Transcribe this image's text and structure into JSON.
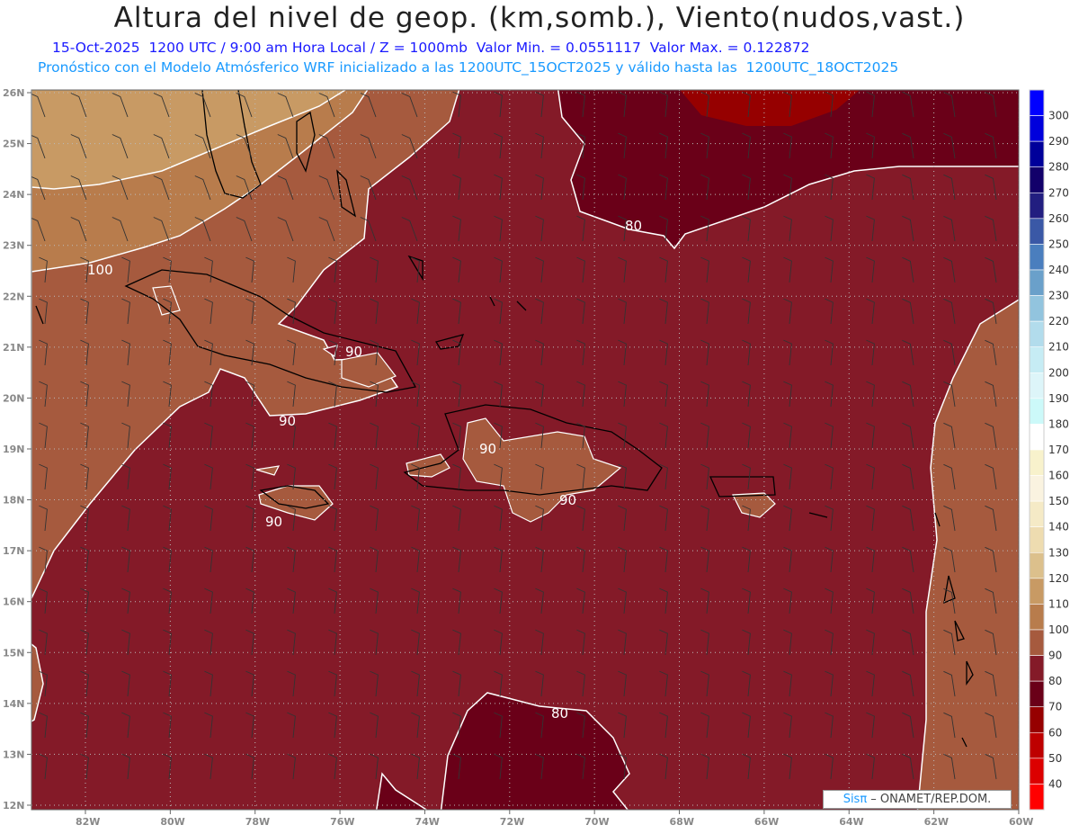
{
  "header": {
    "title": "Altura del nivel de geop. (km,somb.), Viento(nudos,vast.)",
    "subtitle": "15-Oct-2025  1200 UTC / 9:00 am Hora Local / Z = 1000mb  Valor Min. = 0.0551117  Valor Max. = 0.122872",
    "forecast_info": "Pronóstico con el Modelo Atmósferico WRF inicializado a las 1200UTC_15OCT2025 y válido hasta las  1200UTC_18OCT2025"
  },
  "map": {
    "lat_labels": [
      "26N",
      "25N",
      "24N",
      "23N",
      "22N",
      "21N",
      "20N",
      "19N",
      "18N",
      "17N",
      "16N",
      "15N",
      "14N",
      "13N",
      "12N"
    ],
    "lon_labels": [
      "82W",
      "80W",
      "78W",
      "76W",
      "74W",
      "72W",
      "70W",
      "68W",
      "66W",
      "64W",
      "62W",
      "60W"
    ],
    "contour_labels": [
      "100",
      "90",
      "90",
      "90",
      "90",
      "90",
      "80",
      "80"
    ]
  },
  "colorbar": {
    "labels": [
      "300",
      "290",
      "280",
      "270",
      "260",
      "250",
      "240",
      "230",
      "220",
      "210",
      "200",
      "190",
      "180",
      "170",
      "160",
      "150",
      "140",
      "130",
      "120",
      "110",
      "100",
      "90",
      "80",
      "70",
      "60",
      "50",
      "40"
    ],
    "colors": [
      "#0000ff",
      "#0000dc",
      "#00009a",
      "#12006a",
      "#221e80",
      "#3a58a6",
      "#4a7ebe",
      "#6aa0ca",
      "#92c4de",
      "#b2dcec",
      "#c6ecf4",
      "#ddf5f9",
      "#ccf9f9",
      "#ffffff",
      "#f8f2cc",
      "#faf3e0",
      "#f5eac6",
      "#eedcb0",
      "#dcc08c",
      "#c89a64",
      "#b87c4c",
      "#a65a3e",
      "#841a28",
      "#6a0018",
      "#960000",
      "#be0000",
      "#dc0000",
      "#ff0000"
    ]
  },
  "logo": {
    "brand": "Sisπ",
    "text": " – ONAMET/REP.DOM."
  }
}
